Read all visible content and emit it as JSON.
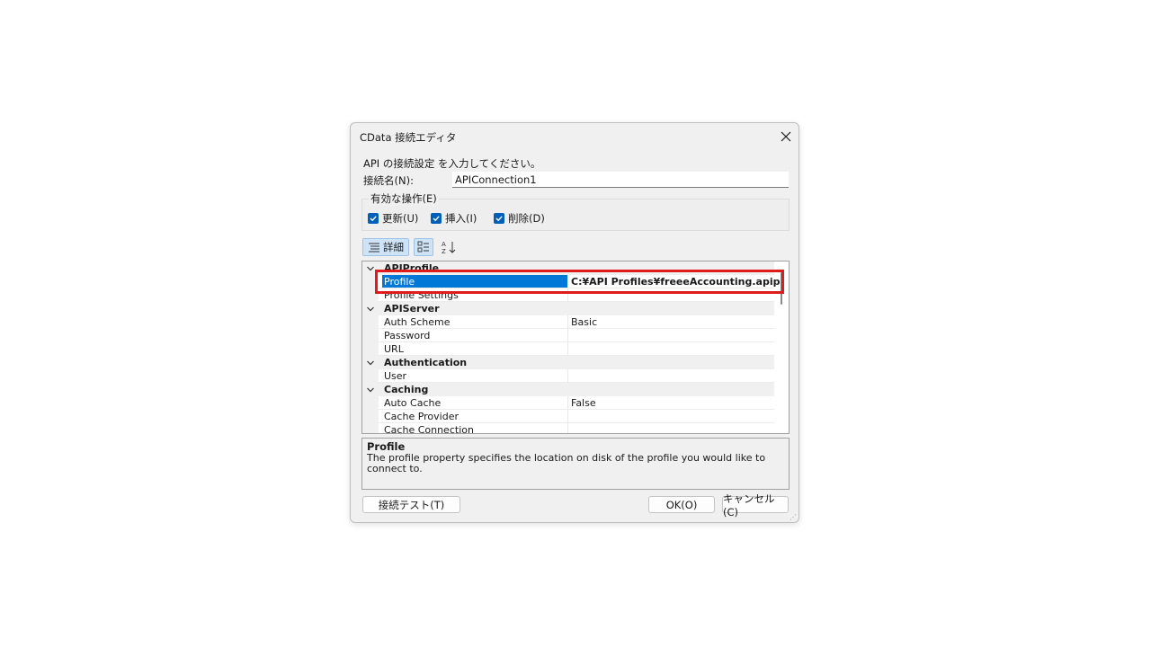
{
  "window": {
    "title": "CData 接続エディタ"
  },
  "form": {
    "instruction": "API の接続設定 を入力してください。",
    "name_label": "接続名(N):",
    "name_value": "APIConnection1"
  },
  "operations": {
    "label": "有効な操作(E)",
    "items": [
      {
        "label": "更新(U)",
        "checked": true
      },
      {
        "label": "挿入(I)",
        "checked": true
      },
      {
        "label": "削除(D)",
        "checked": true
      }
    ]
  },
  "toolbar": {
    "detail_label": "詳細"
  },
  "grid": {
    "rows": [
      {
        "type": "category",
        "name": "APIProfile"
      },
      {
        "type": "property",
        "name": "Profile",
        "value": "C:¥API Profiles¥freeeAccounting.apip",
        "selected": true
      },
      {
        "type": "property",
        "name": "Profile Settings",
        "value": ""
      },
      {
        "type": "category",
        "name": "APIServer"
      },
      {
        "type": "property",
        "name": "Auth Scheme",
        "value": "Basic"
      },
      {
        "type": "property",
        "name": "Password",
        "value": ""
      },
      {
        "type": "property",
        "name": "URL",
        "value": ""
      },
      {
        "type": "category",
        "name": "Authentication"
      },
      {
        "type": "property",
        "name": "User",
        "value": ""
      },
      {
        "type": "category",
        "name": "Caching"
      },
      {
        "type": "property",
        "name": "Auto Cache",
        "value": "False"
      },
      {
        "type": "property",
        "name": "Cache Provider",
        "value": ""
      },
      {
        "type": "property",
        "name": "Cache Connection",
        "value": ""
      }
    ]
  },
  "help": {
    "title": "Profile",
    "description": "The profile property specifies the location on disk of the profile you would like to connect to."
  },
  "buttons": {
    "test": "接続テスト(T)",
    "ok": "OK(O)",
    "cancel": "キャンセル(C)"
  },
  "colors": {
    "accent": "#005fb8",
    "selection": "#0078d7",
    "highlight_border": "#e01b1b"
  }
}
